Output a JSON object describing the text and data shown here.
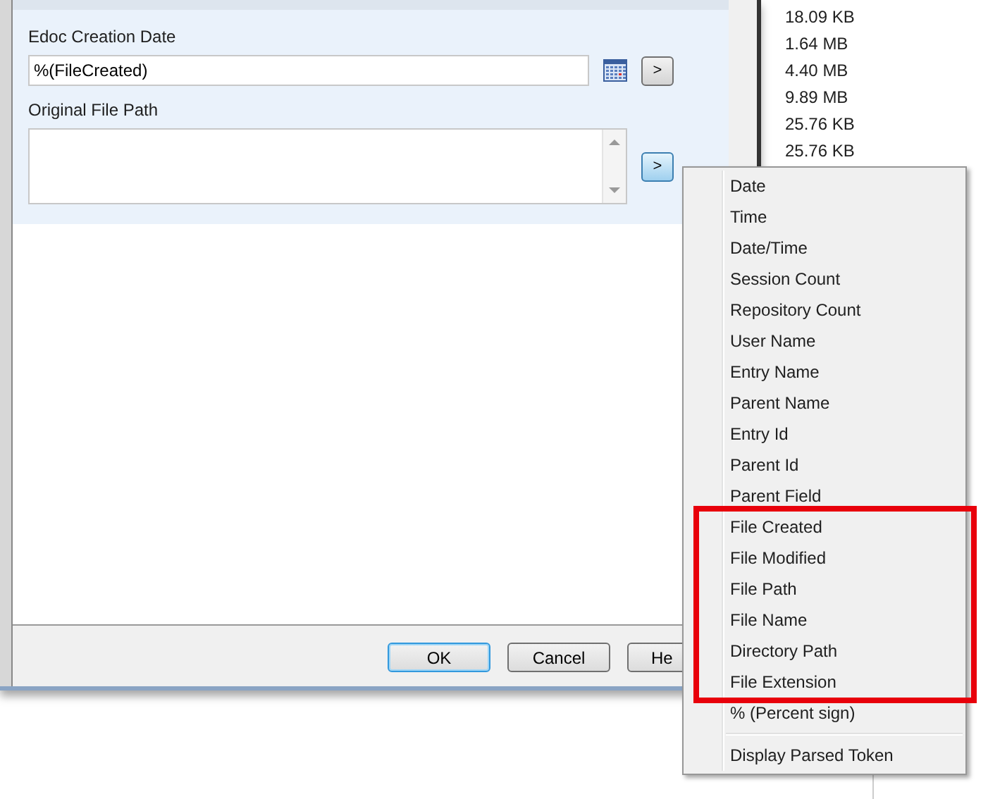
{
  "file_sizes": [
    "18.09 KB",
    "1.64 MB",
    "4.40 MB",
    "9.89 MB",
    "25.76 KB",
    "25.76 KB"
  ],
  "dialog": {
    "fields": [
      {
        "label": "Edoc Creation Date",
        "kind": "date",
        "value": "%(FileCreated)",
        "insert_button": ">",
        "active": false
      },
      {
        "label": "Original File Path",
        "kind": "multiline",
        "insert_button": ">",
        "active": true
      }
    ],
    "buttons": [
      {
        "label": "OK",
        "default": true
      },
      {
        "label": "Cancel",
        "default": false
      },
      {
        "label": "He",
        "default": false
      }
    ]
  },
  "menu": {
    "items": [
      {
        "label": "Date",
        "annotated": false,
        "separator_before": false
      },
      {
        "label": "Time",
        "annotated": false,
        "separator_before": false
      },
      {
        "label": "Date/Time",
        "annotated": false,
        "separator_before": false
      },
      {
        "label": "Session Count",
        "annotated": false,
        "separator_before": false
      },
      {
        "label": "Repository Count",
        "annotated": false,
        "separator_before": false
      },
      {
        "label": "User Name",
        "annotated": false,
        "separator_before": false
      },
      {
        "label": "Entry Name",
        "annotated": false,
        "separator_before": false
      },
      {
        "label": "Parent Name",
        "annotated": false,
        "separator_before": false
      },
      {
        "label": "Entry Id",
        "annotated": false,
        "separator_before": false
      },
      {
        "label": "Parent Id",
        "annotated": false,
        "separator_before": false
      },
      {
        "label": "Parent Field",
        "annotated": false,
        "separator_before": false
      },
      {
        "label": "File Created",
        "annotated": true,
        "separator_before": false
      },
      {
        "label": "File Modified",
        "annotated": true,
        "separator_before": false
      },
      {
        "label": "File Path",
        "annotated": true,
        "separator_before": false
      },
      {
        "label": "File Name",
        "annotated": true,
        "separator_before": false
      },
      {
        "label": "Directory Path",
        "annotated": true,
        "separator_before": false
      },
      {
        "label": "File Extension",
        "annotated": true,
        "separator_before": false
      },
      {
        "label": "% (Percent sign)",
        "annotated": false,
        "separator_before": false
      },
      {
        "label": "Display Parsed Token",
        "annotated": false,
        "separator_before": true
      }
    ]
  }
}
